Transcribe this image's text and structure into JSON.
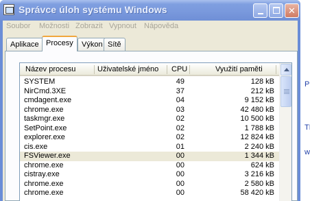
{
  "window": {
    "title": "Správce úloh systému Windows"
  },
  "menu": [
    "Soubor",
    "Možnosti",
    "Zobrazit",
    "Vypnout",
    "Nápověda"
  ],
  "tabs": [
    {
      "label": "Aplikace"
    },
    {
      "label": "Procesy",
      "active": true
    },
    {
      "label": "Výkon"
    },
    {
      "label": "Sítě"
    }
  ],
  "columns": {
    "name": "Název procesu",
    "user": "Uživatelské jméno",
    "cpu": "CPU",
    "mem": "Využití paměti"
  },
  "processes": [
    {
      "name": "SYSTEM",
      "cpu": "49",
      "mem": "128 kB"
    },
    {
      "name": "NirCmd.3XE",
      "cpu": "37",
      "mem": "212 kB"
    },
    {
      "name": "cmdagent.exe",
      "cpu": "04",
      "mem": "9 152 kB"
    },
    {
      "name": "chrome.exe",
      "cpu": "03",
      "mem": "42 480 kB"
    },
    {
      "name": "taskmgr.exe",
      "cpu": "02",
      "mem": "10 500 kB"
    },
    {
      "name": "SetPoint.exe",
      "cpu": "02",
      "mem": "1 788 kB"
    },
    {
      "name": "explorer.exe",
      "cpu": "02",
      "mem": "12 824 kB"
    },
    {
      "name": "cis.exe",
      "cpu": "01",
      "mem": "2 240 kB"
    },
    {
      "name": "FSViewer.exe",
      "cpu": "00",
      "mem": "1 344 kB",
      "selected": true
    },
    {
      "name": "chrome.exe",
      "cpu": "00",
      "mem": "624 kB"
    },
    {
      "name": "cistray.exe",
      "cpu": "00",
      "mem": "3 216 kB"
    },
    {
      "name": "chrome.exe",
      "cpu": "00",
      "mem": "2 580 kB"
    },
    {
      "name": "chrome.exe",
      "cpu": "00",
      "mem": "58 420 kB"
    }
  ],
  "desktop_fragments": [
    "PL",
    "TD",
    "w"
  ]
}
